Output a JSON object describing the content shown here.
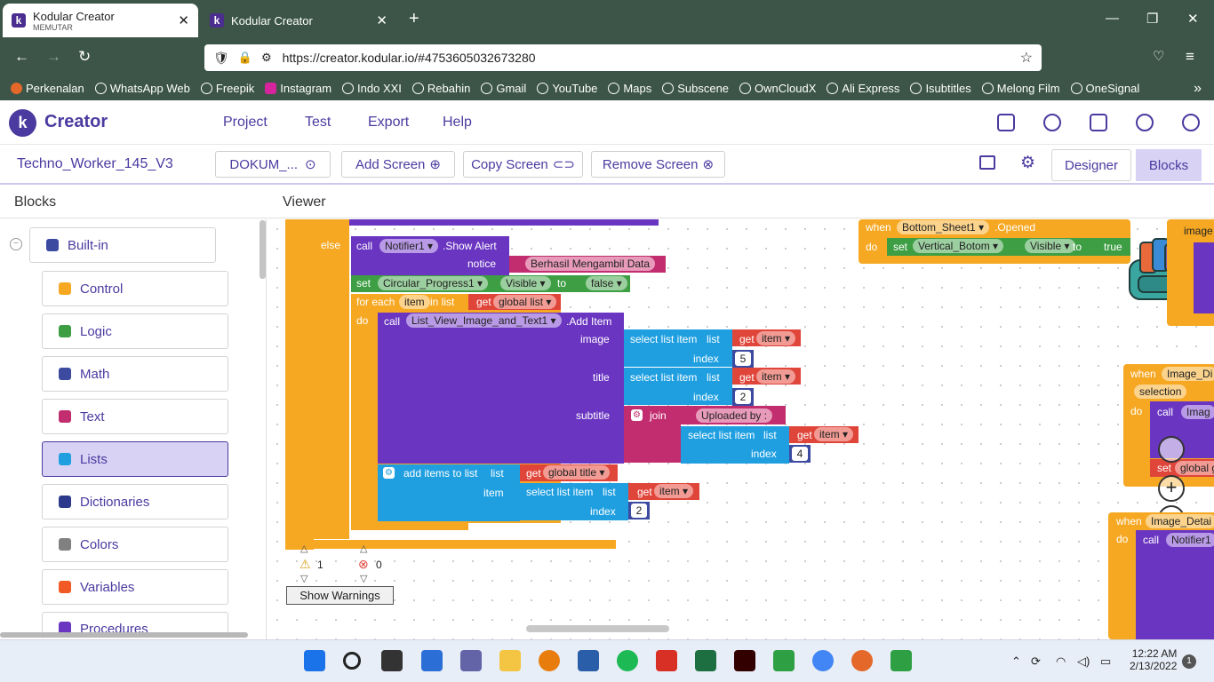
{
  "browser": {
    "tabs": [
      {
        "title": "Kodular Creator",
        "subtitle": "MEMUTAR"
      },
      {
        "title": "Kodular Creator",
        "subtitle": ""
      }
    ],
    "new_tab": "+",
    "url": "https://creator.kodular.io/#4753605032673280",
    "bookmarks": [
      "Perkenalan",
      "WhatsApp Web",
      "Freepik",
      "Instagram",
      "Indo XXI",
      "Rebahin",
      "Gmail",
      "YouTube",
      "Maps",
      "Subscene",
      "OwnCloudX",
      "Ali Express",
      "Isubtitles",
      "Melong Film",
      "OneSignal"
    ]
  },
  "app": {
    "logo_letter": "k",
    "name": "Creator",
    "menu": [
      "Project",
      "Test",
      "Export",
      "Help"
    ],
    "header_icons": [
      "folder-icon",
      "palette-icon",
      "docs-icon",
      "dollar-icon",
      "account-icon"
    ]
  },
  "toolbar": {
    "project": "Techno_Worker_145_V3",
    "screen": "DOKUM_...",
    "add_screen": "Add Screen",
    "copy_screen": "Copy Screen",
    "remove_screen": "Remove Screen",
    "designer": "Designer",
    "blocks": "Blocks"
  },
  "panel": {
    "title": "Blocks",
    "builtin": "Built-in",
    "drawers": [
      {
        "label": "Control",
        "color": "#f6a823"
      },
      {
        "label": "Logic",
        "color": "#3e9e44"
      },
      {
        "label": "Math",
        "color": "#3c4aa0"
      },
      {
        "label": "Text",
        "color": "#c12d6e"
      },
      {
        "label": "Lists",
        "color": "#1f9fe0"
      },
      {
        "label": "Dictionaries",
        "color": "#2d3a8c"
      },
      {
        "label": "Colors",
        "color": "#808080"
      },
      {
        "label": "Variables",
        "color": "#f15a24"
      },
      {
        "label": "Procedures",
        "color": "#6a35c1"
      }
    ],
    "selected": "Lists"
  },
  "viewer": {
    "title": "Viewer",
    "blocks": {
      "else": "else",
      "call": "call",
      "notifier": "Notifier1",
      "show_alert": ".Show Alert",
      "notice": "notice",
      "notice_text": "Berhasil Mengambil Data",
      "set": "set",
      "progress": "Circular_Progress1",
      "visible": "Visible",
      "to": "to",
      "false": "false",
      "for_each": "for each",
      "item": "item",
      "in_list": "in list",
      "get": "get",
      "global_list": "global list",
      "do": "do",
      "list_view": "List_View_Image_and_Text1",
      "add_item": ".Add Item",
      "image": "image",
      "title": "title",
      "subtitle": "subtitle",
      "select_list_item": "select list item",
      "list": "list",
      "index": "index",
      "idx_image": "5",
      "idx_title": "2",
      "idx_sub": "4",
      "join": "join",
      "uploaded_by": "Uploaded by :",
      "add_items": "add items to list",
      "global_title": "global title",
      "item_label": "item",
      "idx_add": "2",
      "when": "when",
      "bottom_sheet": "Bottom_Sheet1",
      "opened": ".Opened",
      "vertical": "Vertical_Botom",
      "true": "true",
      "image_frag": "image",
      "image_di": "Image_Di",
      "selection": "selection",
      "imag": "Imag",
      "global_frag": "global g",
      "image_detail": "Image_Detai",
      "notifier_frag": "Notifier1",
      "warnings": "1",
      "errors": "0",
      "show_warnings": "Show Warnings"
    }
  },
  "taskbar": {
    "time": "12:22 AM",
    "date": "2/13/2022",
    "notif": "1"
  }
}
